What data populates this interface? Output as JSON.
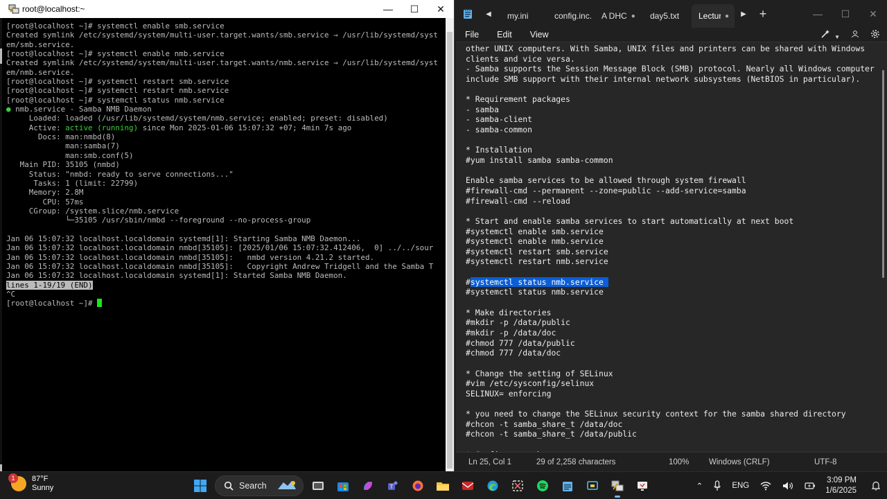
{
  "terminal": {
    "title": "root@localhost:~",
    "lines": [
      {
        "t": "[root@localhost ~]# systemctl enable smb.service"
      },
      {
        "t": "Created symlink /etc/systemd/system/multi-user.target.wants/smb.service → /usr/lib/systemd/syst"
      },
      {
        "t": "em/smb.service."
      },
      {
        "t": "[root@localhost ~]# systemctl enable nmb.service"
      },
      {
        "t": "Created symlink /etc/systemd/system/multi-user.target.wants/nmb.service → /usr/lib/systemd/syst"
      },
      {
        "t": "em/nmb.service."
      },
      {
        "t": "[root@localhost ~]# systemctl restart smb.service"
      },
      {
        "t": "[root@localhost ~]# systemctl restart nmb.service"
      },
      {
        "t": "[root@localhost ~]# systemctl status nmb.service"
      },
      {
        "t": " nmb.service - Samba NMB Daemon",
        "bullet": "●"
      },
      {
        "t": "     Loaded: loaded (/usr/lib/systemd/system/nmb.service; enabled; preset: disabled)"
      },
      {
        "t": "     Active: ",
        "green": "active (running)",
        "rest": " since Mon 2025-01-06 15:07:32 +07; 4min 7s ago"
      },
      {
        "t": "       Docs: man:nmbd(8)"
      },
      {
        "t": "             man:samba(7)"
      },
      {
        "t": "             man:smb.conf(5)"
      },
      {
        "t": "   Main PID: 35105 (nmbd)"
      },
      {
        "t": "     Status: \"nmbd: ready to serve connections...\""
      },
      {
        "t": "      Tasks: 1 (limit: 22799)"
      },
      {
        "t": "     Memory: 2.8M"
      },
      {
        "t": "        CPU: 57ms"
      },
      {
        "t": "     CGroup: /system.slice/nmb.service"
      },
      {
        "t": "             └─35105 /usr/sbin/nmbd --foreground --no-process-group"
      },
      {
        "t": ""
      },
      {
        "t": "Jan 06 15:07:32 localhost.localdomain systemd[1]: Starting Samba NMB Daemon..."
      },
      {
        "t": "Jan 06 15:07:32 localhost.localdomain nmbd[35105]: [2025/01/06 15:07:32.412406,  0] ../../sour"
      },
      {
        "t": "Jan 06 15:07:32 localhost.localdomain nmbd[35105]:   nmbd version 4.21.2 started."
      },
      {
        "t": "Jan 06 15:07:32 localhost.localdomain nmbd[35105]:   Copyright Andrew Tridgell and the Samba T"
      },
      {
        "t": "Jan 06 15:07:32 localhost.localdomain systemd[1]: Started Samba NMB Daemon."
      },
      {
        "t": "",
        "hl": "lines 1-19/19 (END)"
      },
      {
        "t": "^C"
      },
      {
        "t": "[root@localhost ~]# ",
        "cursor": true
      }
    ]
  },
  "notepad": {
    "tabs": [
      {
        "label": "my.ini",
        "active": false,
        "dot": ""
      },
      {
        "label": "config.inc.ph",
        "active": false,
        "dot": ""
      },
      {
        "label": "A DHC",
        "active": false,
        "dot": "●"
      },
      {
        "label": "day5.txt",
        "active": false,
        "dot": ""
      },
      {
        "label": "Lectur",
        "active": true,
        "dot": "●"
      }
    ],
    "add_label": "+",
    "menu": [
      "File",
      "Edit",
      "View"
    ],
    "lines": [
      {
        "t": "other UNIX computers. With Samba, UNIX files and printers can be shared with Windows"
      },
      {
        "t": "clients and vice versa."
      },
      {
        "t": "- Samba supports the Session Message Block (SMB) protocol. Nearly all Windows computers"
      },
      {
        "t": "include SMB support with their internal network subsystems (NetBIOS in particular)."
      },
      {
        "t": ""
      },
      {
        "t": "* Requirement packages"
      },
      {
        "t": "- samba"
      },
      {
        "t": "- samba-client"
      },
      {
        "t": "- samba-common"
      },
      {
        "t": ""
      },
      {
        "t": "* Installation"
      },
      {
        "t": "#yum install samba samba-common"
      },
      {
        "t": ""
      },
      {
        "t": "Enable samba services to be allowed through system firewall"
      },
      {
        "t": "#firewall-cmd --permanent --zone=public --add-service=samba"
      },
      {
        "t": "#firewall-cmd --reload"
      },
      {
        "t": ""
      },
      {
        "t": "* Start and enable samba services to start automatically at next boot"
      },
      {
        "t": "#systemctl enable smb.service"
      },
      {
        "t": "#systemctl enable nmb.service"
      },
      {
        "t": "#systemctl restart smb.service"
      },
      {
        "t": "#systemctl restart nmb.service"
      },
      {
        "t": ""
      },
      {
        "t": "#",
        "sel": "systemctl status nmb.service "
      },
      {
        "t": "#systemctl status nmb.service"
      },
      {
        "t": ""
      },
      {
        "t": "* Make directories"
      },
      {
        "t": "#mkdir -p /data/public"
      },
      {
        "t": "#mkdir -p /data/doc"
      },
      {
        "t": "#chmod 777 /data/public"
      },
      {
        "t": "#chmod 777 /data/doc"
      },
      {
        "t": ""
      },
      {
        "t": "* Change the setting of SELinux"
      },
      {
        "t": "#vim /etc/sysconfig/selinux"
      },
      {
        "t": "SELINUX= enforcing"
      },
      {
        "t": ""
      },
      {
        "t": "* you need to change the SELinux security context for the samba shared directory"
      },
      {
        "t": "#chcon -t samba_share_t /data/doc"
      },
      {
        "t": "#chcon -t samba_share_t /data/public"
      },
      {
        "t": ""
      },
      {
        "t": "* Configure samba"
      }
    ],
    "status": {
      "position": "Ln 25, Col 1",
      "chars": "29 of 2,258 characters",
      "zoom": "100%",
      "eol": "Windows (CRLF)",
      "encoding": "UTF-8"
    }
  },
  "taskbar": {
    "weather_temp": "87°F",
    "weather_desc": "Sunny",
    "weather_badge": "1",
    "search_label": "Search",
    "lang": "ENG",
    "time": "3:09 PM",
    "date": "1/6/2025"
  },
  "colors": {
    "terminal_bg": "#000000",
    "terminal_text": "#bbbbbb",
    "terminal_green": "#36d136",
    "notepad_bg": "#272727",
    "selection": "#0a5ed7"
  }
}
